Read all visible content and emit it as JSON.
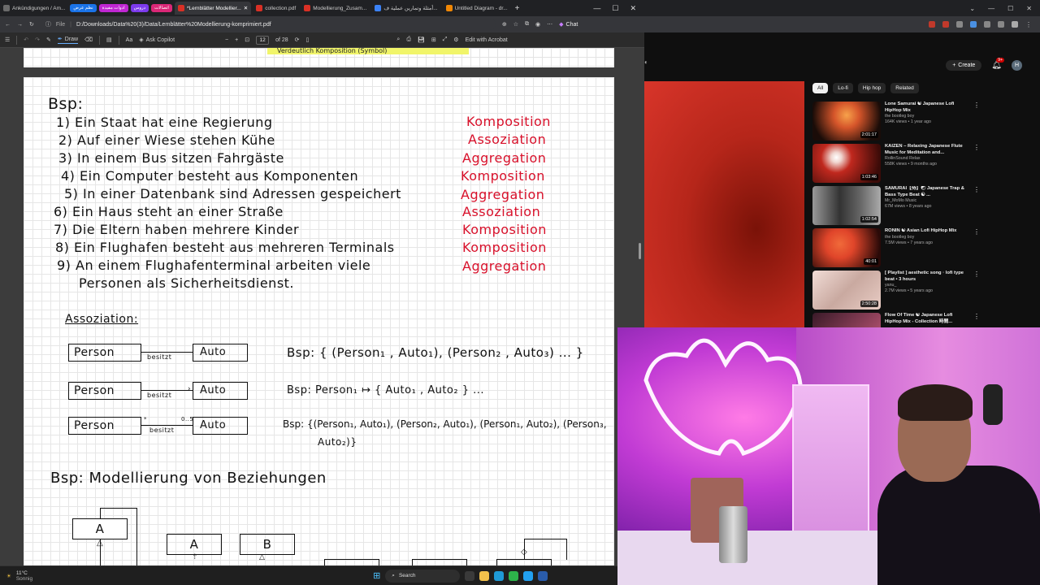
{
  "browser": {
    "tabs": [
      {
        "label": "Ankündigungen / Am...",
        "color": "#6b6b6b",
        "active": false
      },
      {
        "label": "*Lernblätter Modellier...",
        "color": "#d93025",
        "active": true
      },
      {
        "label": "collection.pdf",
        "color": "#d93025",
        "active": false
      },
      {
        "label": "Modellierung_Zusam...",
        "color": "#d93025",
        "active": false
      },
      {
        "label": "أمثلة وتمارين عملية ف...",
        "color": "#3b82f6",
        "active": false
      },
      {
        "label": "Untitled Diagram - dr...",
        "color": "#f08705",
        "active": false
      }
    ],
    "pills": [
      {
        "label": "نظم عرض",
        "color": "#1a73e8"
      },
      {
        "label": "ادوات مفيدة",
        "color": "#c026d3"
      },
      {
        "label": "دروس",
        "color": "#7c3aed"
      },
      {
        "label": "اتصالات",
        "color": "#db2777"
      }
    ],
    "address": {
      "scheme": "File",
      "url": "D:/Downloads/Data%20(3)/Data/Lernblätter%20Modellierung-komprimiert.pdf"
    },
    "chat_label": "Chat"
  },
  "pdf_toolbar": {
    "draw": "Draw",
    "copilot": "Ask Copilot",
    "page": "12",
    "of_pages": "of 28",
    "acrobat": "Edit with Acrobat"
  },
  "page_content": {
    "prev_highlight": "Verdeutlich Komposition (Symbol)",
    "bsp": "Bsp:",
    "sentences": [
      "1) Ein Staat hat eine Regierung",
      "2) Auf einer Wiese stehen Kühe",
      "3) In einem Bus sitzen Fahrgäste",
      "4) Ein Computer besteht aus Komponenten",
      "5) In einer Datenbank sind Adressen gespeichert",
      "6) Ein Haus steht an einer Straße",
      "7) Die Eltern haben mehrere Kinder",
      "8) Ein Flughafen besteht aus mehreren Terminals",
      "9) An einem Flughafenterminal arbeiten viele",
      "Personen als Sicherheitsdienst."
    ],
    "answers": [
      "Komposition",
      "Assoziation",
      "Aggregation",
      "Komposition",
      "Aggregation",
      "Assoziation",
      "Komposition",
      "Komposition",
      "Aggregation"
    ],
    "assoziation_title": "Assoziation:",
    "uml": {
      "left": "Person",
      "right": "Auto",
      "rel": "besitzt",
      "mult_left": "*",
      "mult_right": "0..5"
    },
    "examples": [
      "Bsp:  { (Person₁ , Auto₁), (Person₂ , Auto₃) ... }",
      "Bsp:  Person₁ ↦ { Auto₁ , Auto₂ } ...",
      "Bsp: {(Person₁, Auto₁), (Person₂, Auto₁), (Person₁, Auto₂), (Person₃,",
      "Auto₂)}"
    ],
    "modellierung_title": "Bsp: Modellierung von Beziehungen",
    "boxes": {
      "a1": "A",
      "a2": "A",
      "b": "B"
    }
  },
  "taskbar": {
    "temp": "11°C",
    "weather": "Sonnig",
    "search": "Search"
  },
  "youtube": {
    "create": "Create",
    "notif_count": "9+",
    "avatar": "H",
    "chips": [
      "All",
      "Lo-fi",
      "Hip hop",
      "Related"
    ],
    "recs": [
      {
        "title": "Lone Samurai ☯ Japanese Lofi HipHop Mix",
        "channel": "the bootleg boy",
        "meta": "164K views • 1 year ago",
        "duration": "2:01:17",
        "color1": "#1a0c08",
        "color2": "#d5552a"
      },
      {
        "title": "KAIZEN – Relaxing Japanese Flute Music for Meditation and...",
        "channel": "RollinSound Relax",
        "meta": "558K views • 9 months ago",
        "duration": "1:03:46",
        "color1": "#3b0b08",
        "color2": "#c0281e"
      },
      {
        "title": "SAMURAI【侍】☯ Japanese Trap & Bass Type Beat ☯ ...",
        "channel": "Mr_MoMo Music",
        "meta": "67M views • 8 years ago",
        "duration": "1:02:54",
        "color1": "#222",
        "color2": "#888"
      },
      {
        "title": "RŌNIN ☯ Asian Lofi HipHop Mix",
        "channel": "the bootleg boy",
        "meta": "7.5M views • 7 years ago",
        "duration": "40:01",
        "color1": "#2a0a08",
        "color2": "#e0452a"
      },
      {
        "title": "[ Playlist ] aesthetic song · lofi type beat • 3 hours",
        "channel": "yanu_",
        "meta": "2.7M views • 5 years ago",
        "duration": "2:50:28",
        "color1": "#c9a9a0",
        "color2": "#f1dcd6"
      },
      {
        "title": "Flow Of Time ☯ Japanese Lofi HipHop Mix - Collection 時間...",
        "channel": "",
        "meta": "",
        "duration": "",
        "color1": "#3a1a28",
        "color2": "#c45a7a"
      }
    ]
  }
}
